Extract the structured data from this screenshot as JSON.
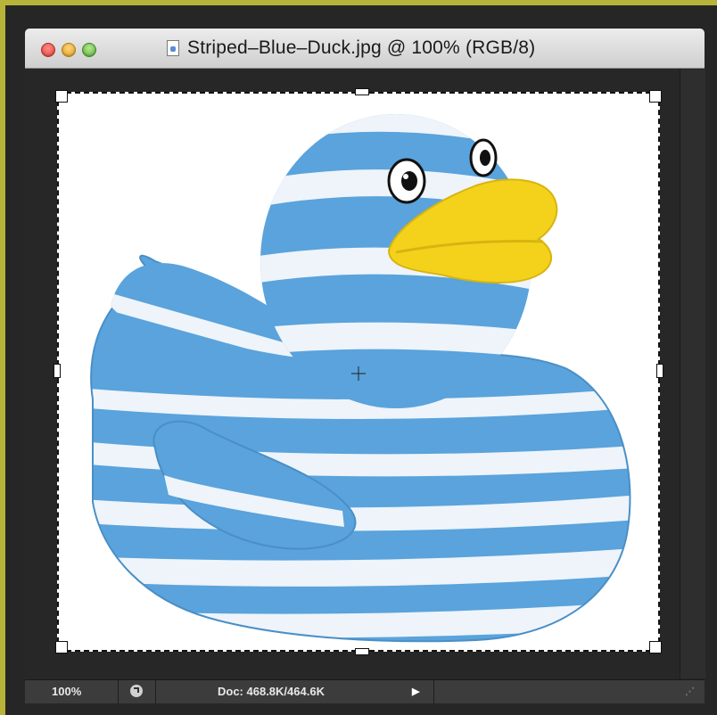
{
  "window": {
    "title": "Striped–Blue–Duck.jpg @ 100% (RGB/8)"
  },
  "icons": {
    "close": "close-traffic-light-icon",
    "minimize": "minimize-traffic-light-icon",
    "zoom": "zoom-traffic-light-icon",
    "document": "document-icon",
    "status_menu": "status-menu-icon",
    "arrow": "triangle-right-icon",
    "resize": "resize-grip-icon"
  },
  "statusbar": {
    "zoom": "100%",
    "doc_size": "Doc: 468.8K/464.6K",
    "arrow": "▶",
    "resize": "⋰"
  },
  "colors": {
    "duck_blue": "#5aa3dc",
    "duck_stripe": "#eef4fa",
    "beak_yellow": "#f4d21c",
    "window_frame": "#b8b43a"
  }
}
